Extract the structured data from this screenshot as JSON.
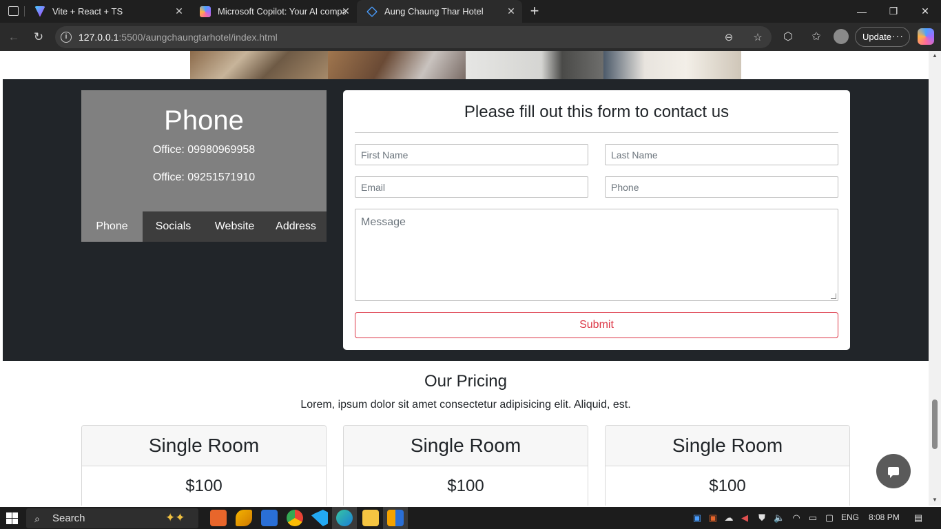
{
  "browser": {
    "tabs": [
      {
        "title": "Vite + React + TS",
        "favicon": "vite-icon",
        "active": false
      },
      {
        "title": "Microsoft Copilot: Your AI compa",
        "favicon": "copilot-icon",
        "active": false
      },
      {
        "title": "Aung Chaung Thar Hotel",
        "favicon": "vscode-liveserver-icon",
        "active": true
      }
    ],
    "new_tab_glyph": "+",
    "close_glyph": "✕",
    "url_host": "127.0.0.1",
    "url_rest": ":5500/aungchaungtarhotel/index.html",
    "update_label": "Update",
    "window_controls": [
      "—",
      "❐",
      "✕"
    ]
  },
  "contact": {
    "phone_card": {
      "heading": "Phone",
      "lines": [
        "Office: 09980969958",
        "Office: 09251571910"
      ],
      "tabs": [
        "Phone",
        "Socials",
        "Website",
        "Address"
      ],
      "active_tab": "Phone"
    },
    "form": {
      "heading": "Please fill out this form to contact us",
      "first_name_placeholder": "First Name",
      "last_name_placeholder": "Last Name",
      "email_placeholder": "Email",
      "phone_placeholder": "Phone",
      "message_placeholder": "Message",
      "submit_label": "Submit"
    }
  },
  "pricing": {
    "title": "Our Pricing",
    "subtitle": "Lorem, ipsum dolor sit amet consectetur adipisicing elit. Aliquid, est.",
    "cards": [
      {
        "room": "Single Room",
        "price": "$100"
      },
      {
        "room": "Single Room",
        "price": "$100"
      },
      {
        "room": "Single Room",
        "price": "$100"
      }
    ]
  },
  "taskbar": {
    "search_label": "Search",
    "language": "ENG",
    "time": "8:08 PM"
  },
  "colors": {
    "band": "#212529",
    "phone_card": "#808080",
    "submit_accent": "#dc3545"
  }
}
